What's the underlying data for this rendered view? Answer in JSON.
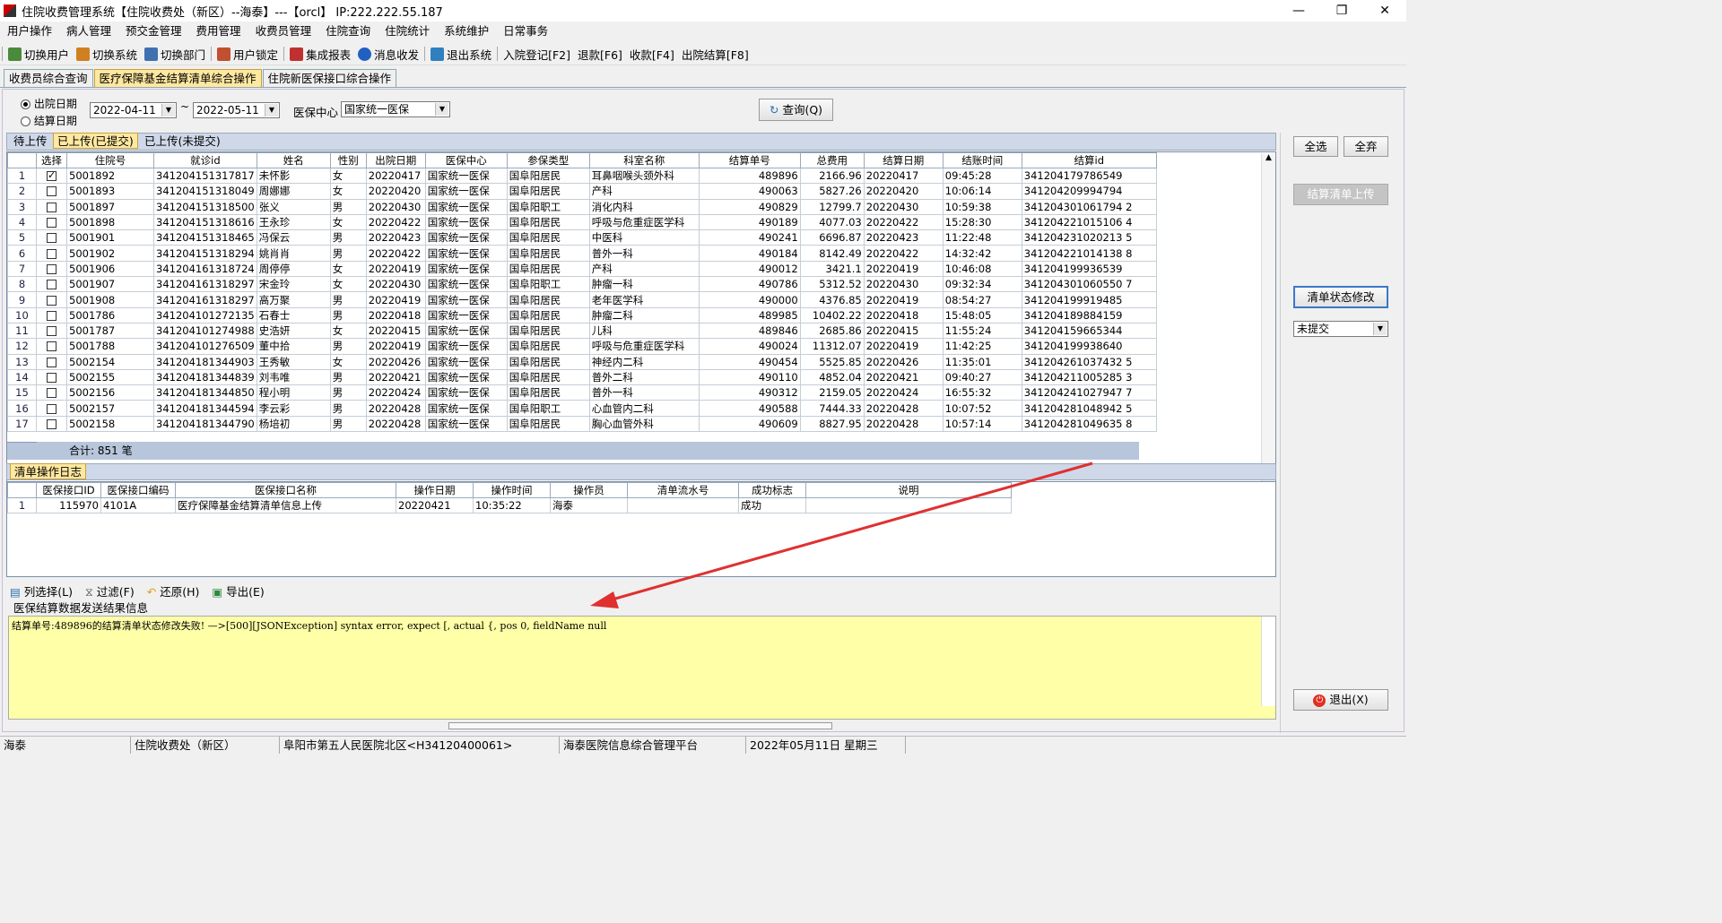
{
  "window": {
    "title": "住院收费管理系统【住院收费处（新区）--海泰】---【orcl】 IP:222.222.55.187",
    "minimize": "—",
    "restore": "❐",
    "close": "✕"
  },
  "menu": [
    "用户操作",
    "病人管理",
    "预交金管理",
    "费用管理",
    "收费员管理",
    "住院查询",
    "住院统计",
    "系统维护",
    "日常事务"
  ],
  "toolbar": [
    {
      "label": "切换用户",
      "icon": "switch-user-icon",
      "color": "#4a8a3a"
    },
    {
      "label": "切换系统",
      "icon": "switch-system-icon",
      "color": "#d08020"
    },
    {
      "label": "切换部门",
      "icon": "switch-dept-icon",
      "color": "#4070b0"
    },
    {
      "label": "用户锁定",
      "icon": "user-lock-icon",
      "color": "#c05030"
    },
    {
      "label": "集成报表",
      "icon": "report-icon",
      "color": "#c03030"
    },
    {
      "label": "消息收发",
      "icon": "info-icon",
      "color": "#2060c0"
    },
    {
      "label": "退出系统",
      "icon": "exit-icon",
      "color": "#3080c0"
    },
    {
      "label": "入院登记[F2]",
      "icon": "",
      "color": ""
    },
    {
      "label": "退款[F6]",
      "icon": "",
      "color": ""
    },
    {
      "label": "收款[F4]",
      "icon": "",
      "color": ""
    },
    {
      "label": "出院结算[F8]",
      "icon": "",
      "color": ""
    }
  ],
  "tabs": [
    "收费员综合查询",
    "医疗保障基金结算清单综合操作",
    "住院新医保接口综合操作"
  ],
  "query": {
    "radio_discharge": "出院日期",
    "radio_settle": "结算日期",
    "date_from": "2022-04-11",
    "tilde": "~",
    "date_to": "2022-05-11",
    "center_label": "医保中心",
    "center_value": "国家统一医保",
    "query_button": "查询(Q)"
  },
  "subtabs": [
    "待上传",
    "已上传(已提交)",
    "已上传(未提交)"
  ],
  "grid": {
    "columns": [
      "选择",
      "住院号",
      "就诊id",
      "姓名",
      "性别",
      "出院日期",
      "医保中心",
      "参保类型",
      "科室名称",
      "结算单号",
      "总费用",
      "结算日期",
      "结账时间",
      "结算id"
    ],
    "rows": [
      [
        "1",
        true,
        "5001892",
        "341204151317817",
        "未怀影",
        "女",
        "20220417",
        "国家统一医保",
        "国阜阳居民",
        "耳鼻咽喉头颈外科",
        "489896",
        "2166.96",
        "20220417",
        "09:45:28",
        "341204179786549"
      ],
      [
        "2",
        false,
        "5001893",
        "341204151318049",
        "周娜娜",
        "女",
        "20220420",
        "国家统一医保",
        "国阜阳居民",
        "产科",
        "490063",
        "5827.26",
        "20220420",
        "10:06:14",
        "341204209994794"
      ],
      [
        "3",
        false,
        "5001897",
        "341204151318500",
        "张义",
        "男",
        "20220430",
        "国家统一医保",
        "国阜阳职工",
        "消化内科",
        "490829",
        "12799.7",
        "20220430",
        "10:59:38",
        "341204301061794 2"
      ],
      [
        "4",
        false,
        "5001898",
        "341204151318616",
        "王永珍",
        "女",
        "20220422",
        "国家统一医保",
        "国阜阳居民",
        "呼吸与危重症医学科",
        "490189",
        "4077.03",
        "20220422",
        "15:28:30",
        "341204221015106 4"
      ],
      [
        "5",
        false,
        "5001901",
        "341204151318465",
        "冯保云",
        "男",
        "20220423",
        "国家统一医保",
        "国阜阳居民",
        "中医科",
        "490241",
        "6696.87",
        "20220423",
        "11:22:48",
        "341204231020213 5"
      ],
      [
        "6",
        false,
        "5001902",
        "341204151318294",
        "姚肖肖",
        "男",
        "20220422",
        "国家统一医保",
        "国阜阳居民",
        "普外一科",
        "490184",
        "8142.49",
        "20220422",
        "14:32:42",
        "341204221014138 8"
      ],
      [
        "7",
        false,
        "5001906",
        "341204161318724",
        "周停停",
        "女",
        "20220419",
        "国家统一医保",
        "国阜阳居民",
        "产科",
        "490012",
        "3421.1",
        "20220419",
        "10:46:08",
        "341204199936539"
      ],
      [
        "8",
        false,
        "5001907",
        "341204161318297",
        "宋金玲",
        "女",
        "20220430",
        "国家统一医保",
        "国阜阳职工",
        "肿瘤一科",
        "490786",
        "5312.52",
        "20220430",
        "09:32:34",
        "341204301060550 7"
      ],
      [
        "9",
        false,
        "5001908",
        "341204161318297",
        "高万聚",
        "男",
        "20220419",
        "国家统一医保",
        "国阜阳居民",
        "老年医学科",
        "490000",
        "4376.85",
        "20220419",
        "08:54:27",
        "341204199919485"
      ],
      [
        "10",
        false,
        "5001786",
        "341204101272135",
        "石春士",
        "男",
        "20220418",
        "国家统一医保",
        "国阜阳居民",
        "肿瘤二科",
        "489985",
        "10402.22",
        "20220418",
        "15:48:05",
        "341204189884159"
      ],
      [
        "11",
        false,
        "5001787",
        "341204101274988",
        "史浩妍",
        "女",
        "20220415",
        "国家统一医保",
        "国阜阳居民",
        "儿科",
        "489846",
        "2685.86",
        "20220415",
        "11:55:24",
        "341204159665344"
      ],
      [
        "12",
        false,
        "5001788",
        "341204101276509",
        "董中拾",
        "男",
        "20220419",
        "国家统一医保",
        "国阜阳居民",
        "呼吸与危重症医学科",
        "490024",
        "11312.07",
        "20220419",
        "11:42:25",
        "341204199938640"
      ],
      [
        "13",
        false,
        "5002154",
        "341204181344903",
        "王秀敏",
        "女",
        "20220426",
        "国家统一医保",
        "国阜阳居民",
        "神经内二科",
        "490454",
        "5525.85",
        "20220426",
        "11:35:01",
        "341204261037432 5"
      ],
      [
        "14",
        false,
        "5002155",
        "341204181344839",
        "刘韦唯",
        "男",
        "20220421",
        "国家统一医保",
        "国阜阳居民",
        "普外二科",
        "490110",
        "4852.04",
        "20220421",
        "09:40:27",
        "341204211005285 3"
      ],
      [
        "15",
        false,
        "5002156",
        "341204181344850",
        "程小明",
        "男",
        "20220424",
        "国家统一医保",
        "国阜阳居民",
        "普外一科",
        "490312",
        "2159.05",
        "20220424",
        "16:55:32",
        "341204241027947 7"
      ],
      [
        "16",
        false,
        "5002157",
        "341204181344594",
        "李云彩",
        "男",
        "20220428",
        "国家统一医保",
        "国阜阳职工",
        "心血管内二科",
        "490588",
        "7444.33",
        "20220428",
        "10:07:52",
        "341204281048942 5"
      ],
      [
        "17",
        false,
        "5002158",
        "341204181344790",
        "杨培初",
        "男",
        "20220428",
        "国家统一医保",
        "国阜阳居民",
        "胸心血管外科",
        "490609",
        "8827.95",
        "20220428",
        "10:57:14",
        "341204281049635 8"
      ]
    ],
    "footer": "合计: 851 笔"
  },
  "right_panel": {
    "select_all": "全选",
    "deselect_all": "全弃",
    "upload_button": "结算清单上传",
    "status_modify_button": "清单状态修改",
    "status_select": "未提交",
    "exit_button": "退出(X)"
  },
  "log": {
    "tab": "清单操作日志",
    "columns": [
      "医保接口ID",
      "医保接口编码",
      "医保接口名称",
      "操作日期",
      "操作时间",
      "操作员",
      "清单流水号",
      "成功标志",
      "说明"
    ],
    "rows": [
      [
        "1",
        "115970",
        "4101A",
        "医疗保障基金结算清单信息上传",
        "20220421",
        "10:35:22",
        "海泰",
        "",
        "成功",
        ""
      ]
    ]
  },
  "log_toolbar": [
    "列选择(L)",
    "过滤(F)",
    "还原(H)",
    "导出(E)"
  ],
  "result": {
    "label": "医保结算数据发送结果信息",
    "text": "结算单号:489896的结算清单状态修改失败! —>[500][JSONException] syntax error, expect [, actual {, pos 0, fieldName null"
  },
  "statusbar": [
    "海泰",
    "住院收费处（新区）",
    "阜阳市第五人民医院北区<H34120400061>",
    "海泰医院信息综合管理平台",
    "2022年05月11日 星期三"
  ],
  "annotation": {
    "color": "#e03030"
  }
}
